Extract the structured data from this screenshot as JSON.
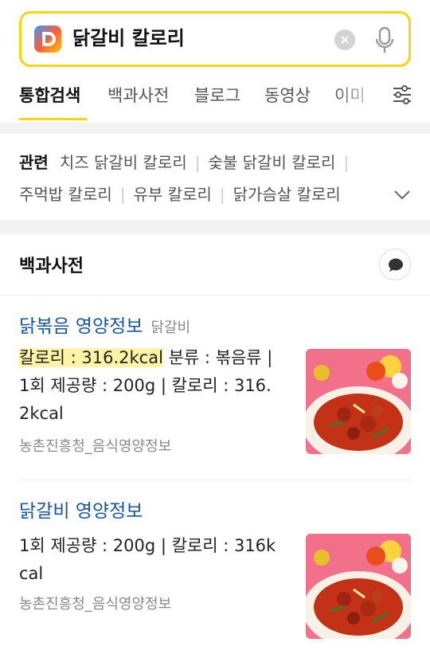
{
  "search": {
    "query": "닭갈비 칼로리",
    "clear_icon": "close-circle-icon",
    "mic_icon": "microphone-icon",
    "accent_color": "#f5d60f"
  },
  "tabs": [
    {
      "label": "통합검색",
      "active": true
    },
    {
      "label": "백과사전",
      "active": false
    },
    {
      "label": "블로그",
      "active": false
    },
    {
      "label": "동영상",
      "active": false
    },
    {
      "label": "이미",
      "active": false
    }
  ],
  "related": {
    "label": "관련",
    "items": [
      "치즈 닭갈비 칼로리",
      "숯불 닭갈비 칼로리",
      "주먹밥 칼로리",
      "유부 칼로리",
      "닭가슴살 칼로리"
    ]
  },
  "encyclopedia": {
    "title": "백과사전",
    "results": [
      {
        "title": "닭볶음 영양정보",
        "subtitle": "닭갈비",
        "highlight": "칼로리 : 316.2kcal",
        "desc_line1_rest": " 분류 : 볶음류 |",
        "desc_line2": "1회 제공량 : 200g | 칼로리 : 316.",
        "desc_line3": "2kcal",
        "source": "농촌진흥청_음식영양정보"
      },
      {
        "title": "닭갈비 영양정보",
        "desc_line1": "1회 제공량 : 200g | 칼로리 : 316k",
        "desc_line2": "cal",
        "source": "농촌진흥청_음식영양정보"
      }
    ]
  }
}
